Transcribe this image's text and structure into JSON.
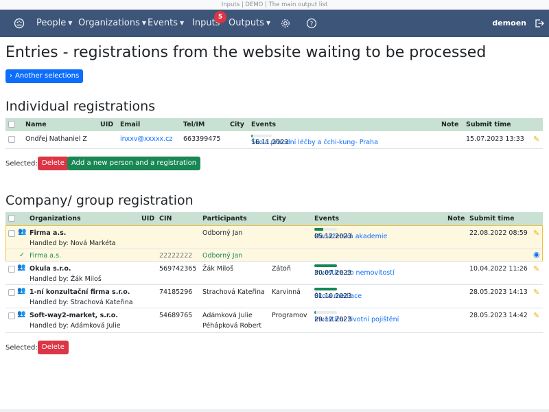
{
  "window": {
    "title": "Inputs | DEMO | The main output list"
  },
  "navbar": {
    "people": "People",
    "organizations": "Organizations",
    "events": "Events",
    "inputs": "Inputs",
    "inputs_badge": "5",
    "outputs": "Outputs",
    "user": "demoen",
    "icons": [
      "palette-icon",
      "gear-icon",
      "help-icon",
      "logout-icon"
    ]
  },
  "page": {
    "title": "Entries - registrations from the website waiting to be processed",
    "another_selections": "Another selections"
  },
  "individual": {
    "heading": "Individual registrations",
    "columns": {
      "name": "Name",
      "uid": "UID",
      "email": "Email",
      "tel": "Tel/IM",
      "city": "City",
      "events": "Events",
      "note": "Note",
      "submit": "Submit time"
    },
    "rows": [
      {
        "name": "Ondřej Nathaniel Z",
        "uid": "",
        "email": "inxxv@xxxxx.cz",
        "tel": "663399475",
        "city": "",
        "event_link": "Škola přírodní léčby a čchi-kung- Praha",
        "event_date": "16.11.2023",
        "progress": 0.06,
        "note": "",
        "submit": "15.07.2023 13:33"
      }
    ],
    "selected_label": "Selected:",
    "delete": "Delete",
    "add_person": "Add a new person and a registration"
  },
  "company": {
    "heading": "Company/ group registration",
    "columns": {
      "organizations": "Organizations",
      "uid": "UID",
      "cin": "CIN",
      "participants": "Participants",
      "city": "City",
      "events": "Events",
      "note": "Note",
      "submit": "Submit time"
    },
    "rows": [
      {
        "org": "Firma a.s.",
        "handled": "Handled by: Nová Markéta",
        "cin": "",
        "participants": [
          "Odborný Jan"
        ],
        "city": "",
        "event_link": "Manažerská akademie",
        "event_date": "05.12.2023",
        "progress": 0.4,
        "submit": "22.08.2022 08:59",
        "sub": {
          "org": "Firma a.s.",
          "cin": "22222222",
          "participant": "Odborný Jan"
        }
      },
      {
        "org": "Okula s.r.o.",
        "handled": "Handled by: Žák Miloš",
        "cin": "569742365",
        "participants": [
          "Žák Miloš"
        ],
        "city": "Zátoň",
        "event_link": "Investice do nemovitostí",
        "event_date": "30.07.2023",
        "progress": 1.0,
        "submit": "10.04.2022 11:26"
      },
      {
        "org": "1-ní konzultační firma s.r.o.",
        "handled": "Handled by: Strachová Kateřina",
        "cin": "74185296",
        "participants": [
          "Strachová Kateřina"
        ],
        "city": "Karvinná",
        "event_link": "Škola mediace",
        "event_date": "01.10.2023",
        "progress": 1.0,
        "submit": "28.05.2023 14:13"
      },
      {
        "org": "Soft-way2-market, s.r.o.",
        "handled": "Handled by: Adámková Julie",
        "cin": "54689765",
        "participants": [
          "Adámková Julie",
          "Péhápková Robert"
        ],
        "city": "Programov",
        "event_link": "Investiční životní pojištění",
        "event_date": "29.12.2023",
        "progress": 0.06,
        "submit": "28.05.2023 14:42"
      }
    ],
    "selected_label": "Selected:",
    "delete": "Delete"
  }
}
